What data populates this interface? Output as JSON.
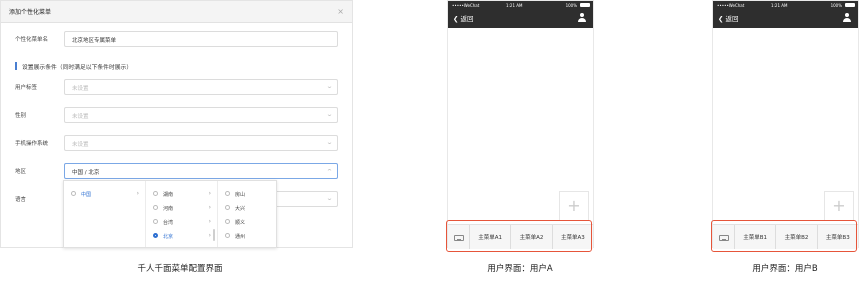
{
  "dialog": {
    "title": "添加个性化菜单",
    "close": "×",
    "name_field": {
      "label": "个性化菜单名",
      "value": "北京地区专属菜单"
    },
    "section": "设置展示条件（同时满足以下条件时展示）",
    "fields": [
      {
        "label": "用户标签",
        "placeholder": "未设置"
      },
      {
        "label": "性别",
        "placeholder": "未设置"
      },
      {
        "label": "手机操作系统",
        "placeholder": "未设置"
      }
    ],
    "region": {
      "label": "地区",
      "value": "中国 / 北京"
    },
    "language": {
      "label": "语言"
    },
    "cascader": {
      "country": {
        "label": "中国",
        "selected": true
      },
      "provinces": [
        "湖南",
        "河南",
        "台湾",
        "北京"
      ],
      "selected_province": "北京",
      "cities": [
        "房山",
        "大兴",
        "顺义",
        "通州"
      ]
    }
  },
  "phones": [
    {
      "status": {
        "carrier": "•••••WeChat",
        "time": "1:21 AM",
        "battery": "100%"
      },
      "back_label": "返回",
      "plus": "+",
      "menu": [
        "主菜单A1",
        "主菜单A2",
        "主菜单A3"
      ],
      "caption": "用户界面：用户A"
    },
    {
      "status": {
        "carrier": "•••••WeChat",
        "time": "1:21 AM",
        "battery": "100%"
      },
      "back_label": "返回",
      "plus": "+",
      "menu": [
        "主菜单B1",
        "主菜单B2",
        "主菜单B3"
      ],
      "caption": "用户界面：用户B"
    }
  ],
  "captions": {
    "left": "千人千面菜单配置界面"
  },
  "colors": {
    "accent": "#2d6fd1",
    "highlight": "#e6553a",
    "nav": "#2e2e2e"
  }
}
